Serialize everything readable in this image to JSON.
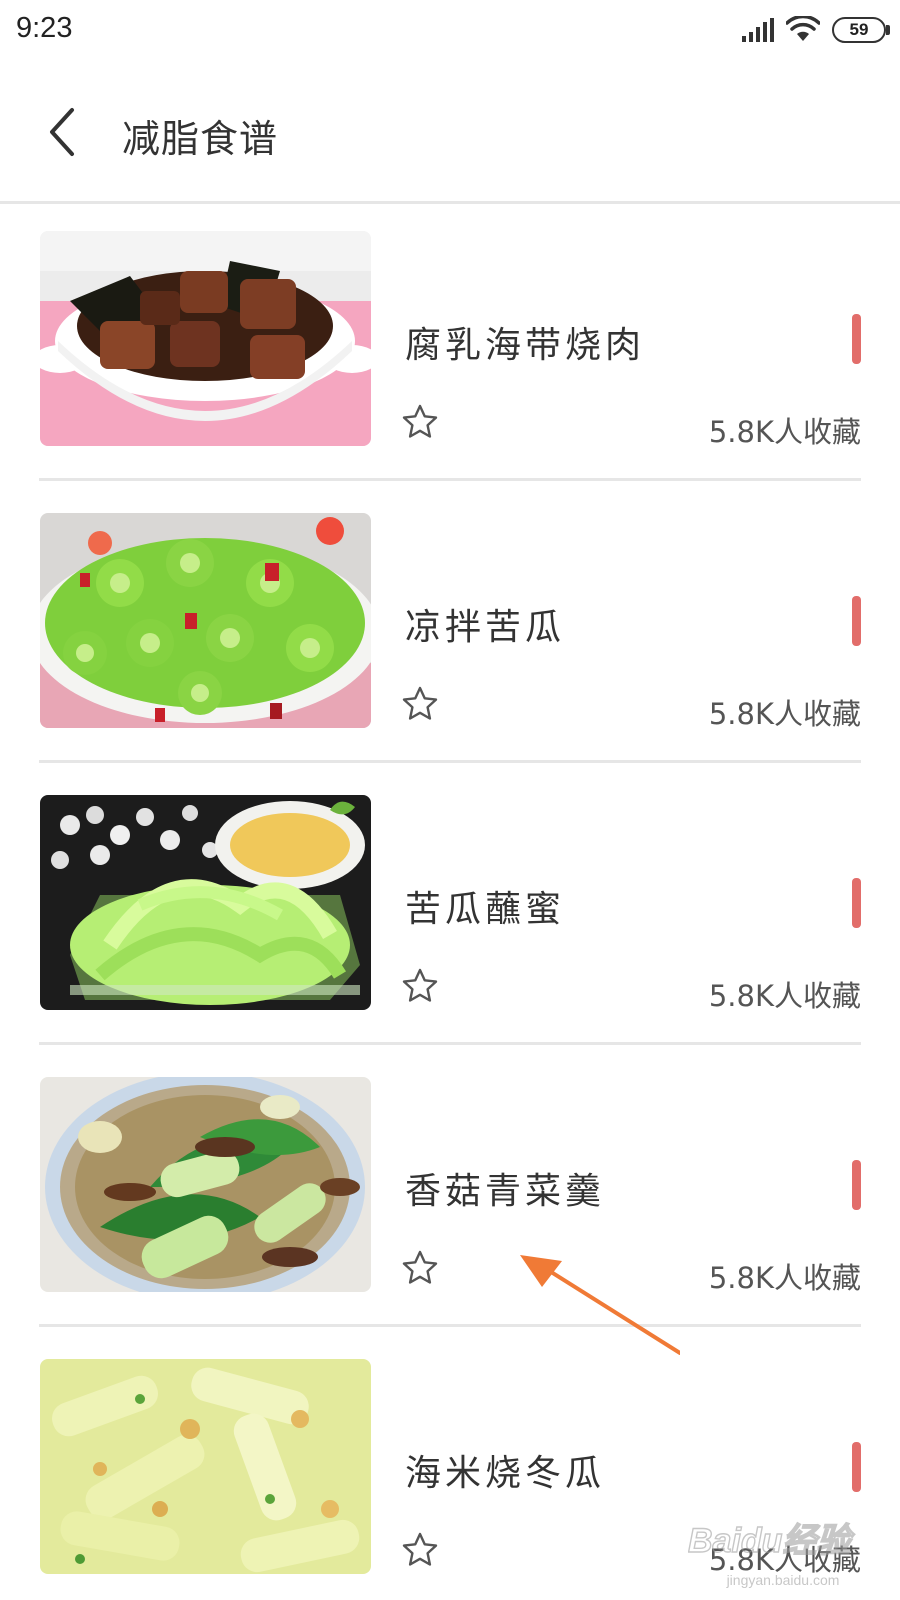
{
  "status_bar": {
    "time": "9:23",
    "battery": "59",
    "signal_icon": "signal-bars-icon",
    "wifi_icon": "wifi-icon"
  },
  "header": {
    "title": "减脂食谱",
    "back_icon": "chevron-left-icon"
  },
  "recipes": [
    {
      "name": "腐乳海带烧肉",
      "favorites": "5.8K人收藏",
      "thumbnail": "braised pork with kelp in white bowl"
    },
    {
      "name": "凉拌苦瓜",
      "favorites": "5.8K人收藏",
      "thumbnail": "sliced bitter melon salad with red chili"
    },
    {
      "name": "苦瓜蘸蜜",
      "favorites": "5.8K人收藏",
      "thumbnail": "shaved bitter melon with honey dip"
    },
    {
      "name": "香菇青菜羹",
      "favorites": "5.8K人收藏",
      "thumbnail": "mushroom and bok choy soup"
    },
    {
      "name": "海米烧冬瓜",
      "favorites": "5.8K人收藏",
      "thumbnail": "winter melon with dried shrimp"
    }
  ],
  "colors": {
    "accent_marker": "#e26d6a",
    "annotation_arrow": "#f07a36",
    "divider": "#e6e6e6"
  },
  "watermark": {
    "logo_text": "Baidu经验",
    "url": "jingyan.baidu.com"
  }
}
